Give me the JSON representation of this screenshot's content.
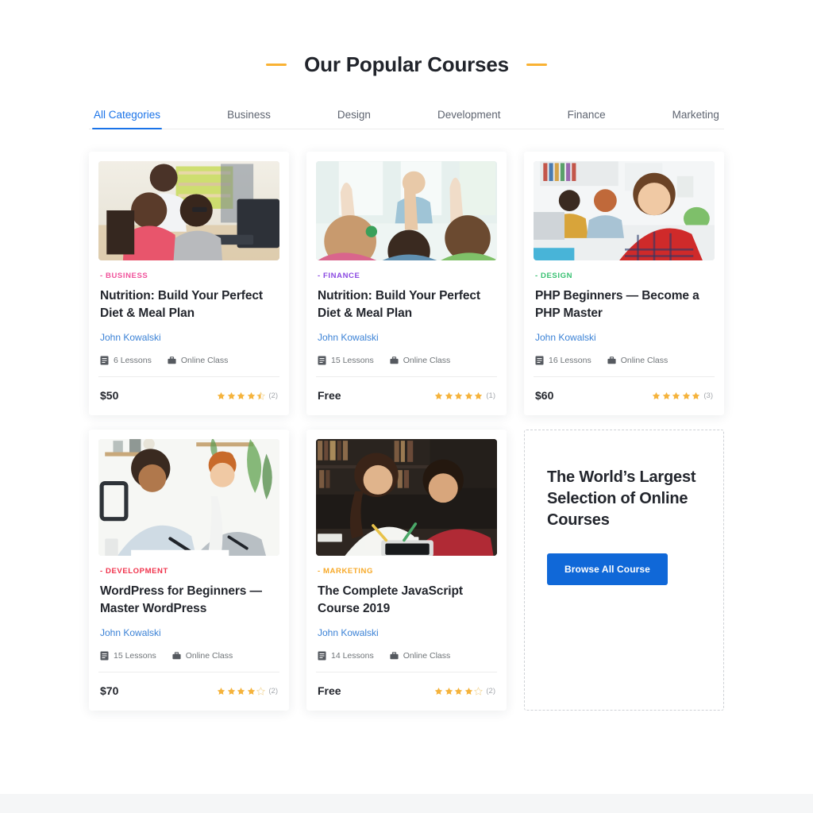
{
  "header": {
    "title": "Our Popular Courses",
    "accent_color": "#f9b233"
  },
  "tabs": {
    "active": "All Categories",
    "items": [
      {
        "label": "All Categories"
      },
      {
        "label": "Business"
      },
      {
        "label": "Design"
      },
      {
        "label": "Development"
      },
      {
        "label": "Finance"
      },
      {
        "label": "Marketing"
      }
    ],
    "active_color": "#1a73e8",
    "inactive_color": "#5e6470"
  },
  "courses": [
    {
      "category": "- BUSINESS",
      "category_color": "#f0529b",
      "title": "Nutrition: Build Your Perfect Diet & Meal Plan",
      "author": "John Kowalski",
      "lessons": "6 Lessons",
      "class_type": "Online Class",
      "price": "$50",
      "rating": 4.5,
      "review_count": "(2)",
      "image_alt": "people-at-computers-photo"
    },
    {
      "category": "- FINANCE",
      "category_color": "#8b4ae2",
      "title": "Nutrition: Build Your Perfect Diet & Meal Plan",
      "author": "John Kowalski",
      "lessons": "15 Lessons",
      "class_type": "Online Class",
      "price": "Free",
      "rating": 5,
      "review_count": "(1)",
      "image_alt": "classroom-raised-hands-photo"
    },
    {
      "category": "- DESIGN",
      "category_color": "#38c172",
      "title": "PHP Beginners — Become a PHP Master",
      "author": "John Kowalski",
      "lessons": "16 Lessons",
      "class_type": "Online Class",
      "price": "$60",
      "rating": 5,
      "review_count": "(3)",
      "image_alt": "student-in-plaid-shirt-photo"
    },
    {
      "category": "- DEVELOPMENT",
      "category_color": "#f0324b",
      "title": "WordPress for Beginners — Master WordPress",
      "author": "John Kowalski",
      "lessons": "15 Lessons",
      "class_type": "Online Class",
      "price": "$70",
      "rating": 4,
      "review_count": "(2)",
      "image_alt": "two-people-working-together-photo"
    },
    {
      "category": "- MARKETING",
      "category_color": "#f7a928",
      "title": "The Complete JavaScript Course 2019",
      "author": "John Kowalski",
      "lessons": "14 Lessons",
      "class_type": "Online Class",
      "price": "Free",
      "rating": 4,
      "review_count": "(2)",
      "image_alt": "students-studying-in-library-photo"
    }
  ],
  "promo": {
    "title": "The World’s Largest Selection of Online Courses",
    "button_label": "Browse All Course",
    "button_color": "#1068d8"
  },
  "icons": {
    "lessons": "document-icon",
    "class": "briefcase-icon",
    "star": "star-icon"
  },
  "star_color": "#f5b33c",
  "star_empty_color": "#f3d79b"
}
